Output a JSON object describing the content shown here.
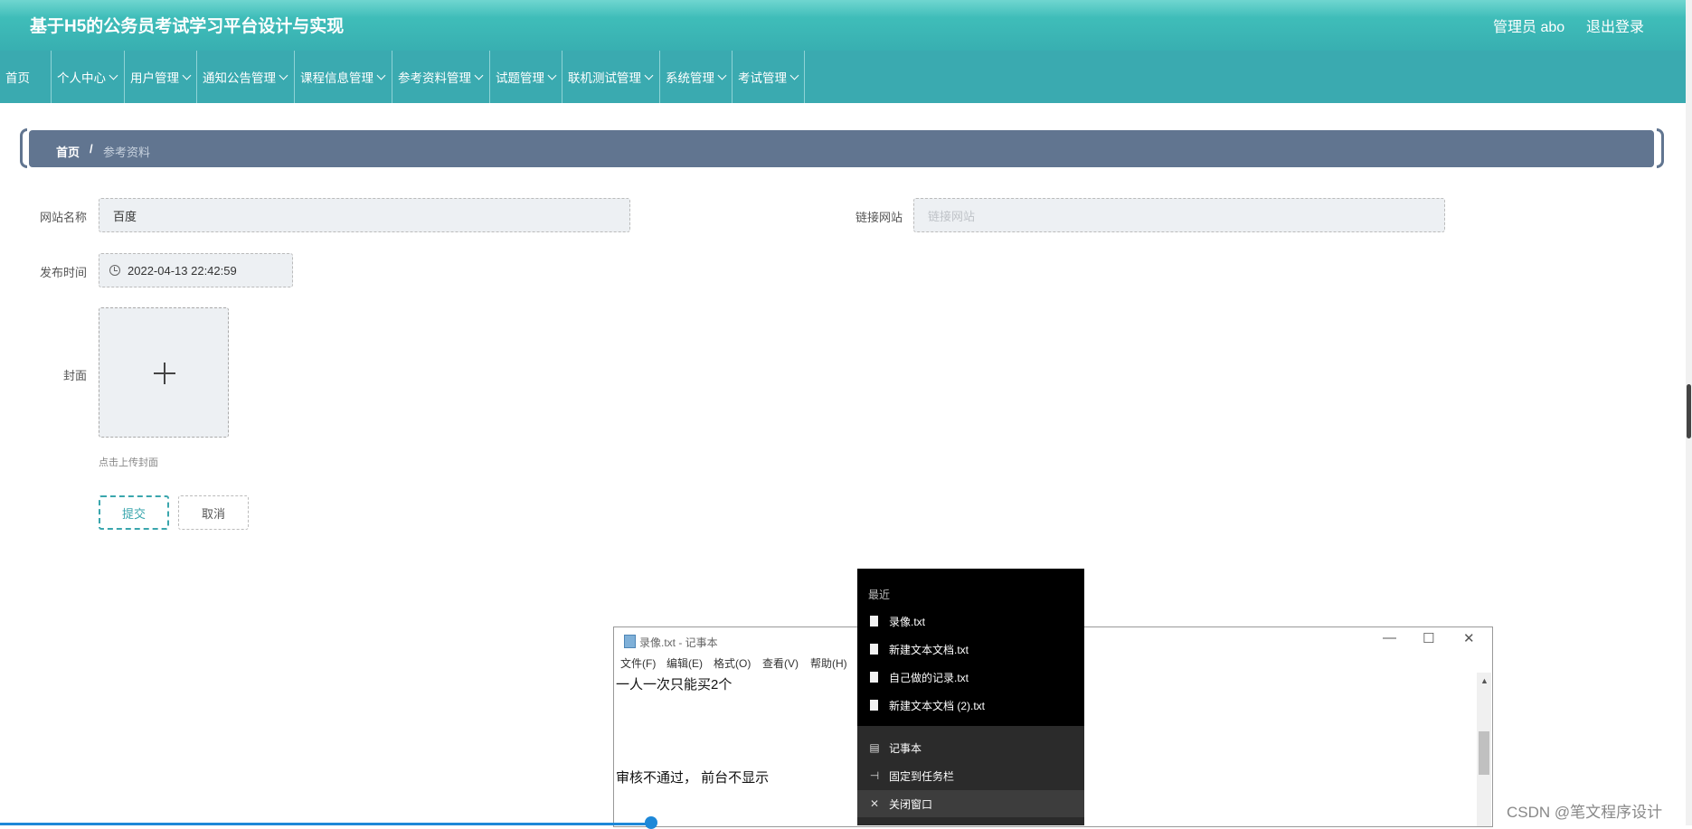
{
  "header": {
    "app_title": "基于H5的公务员考试学习平台设计与实现",
    "user_label": "管理员 abo",
    "logout_label": "退出登录"
  },
  "nav": {
    "home": "首页",
    "items": [
      "个人中心",
      "用户管理",
      "通知公告管理",
      "课程信息管理",
      "参考资料管理",
      "试题管理",
      "联机测试管理",
      "系统管理",
      "考试管理"
    ]
  },
  "breadcrumb": {
    "home": "首页",
    "separator": "/",
    "current": "参考资料"
  },
  "form": {
    "site_name_label": "网站名称",
    "site_name_value": "百度",
    "link_label": "链接网站",
    "link_placeholder": "链接网站",
    "publish_time_label": "发布时间",
    "publish_time_value": "2022-04-13 22:42:59",
    "cover_label": "封面",
    "cover_hint": "点击上传封面",
    "submit_label": "提交",
    "cancel_label": "取消"
  },
  "notepad": {
    "title": "录像.txt - 记事本",
    "menu": [
      "文件(F)",
      "编辑(E)",
      "格式(O)",
      "查看(V)",
      "帮助(H)"
    ],
    "lines": [
      "一人一次只能买2个",
      "审核不通过， 前台不显示"
    ],
    "controls": {
      "minimize": "—",
      "maximize": "☐",
      "close": "✕"
    }
  },
  "jumplist": {
    "section_label": "最近",
    "recent": [
      "录像.txt",
      "新建文本文档.txt",
      "自己做的记录.txt",
      "新建文本文档 (2).txt"
    ],
    "app_name": "记事本",
    "pin_label": "固定到任务栏",
    "close_label": "关闭窗口"
  },
  "watermark": "CSDN @笔文程序设计",
  "colors": {
    "header": "#3fbdb9",
    "nav": "#3aaab0",
    "breadcrumb": "#617590",
    "accent": "#3aa6ad"
  }
}
